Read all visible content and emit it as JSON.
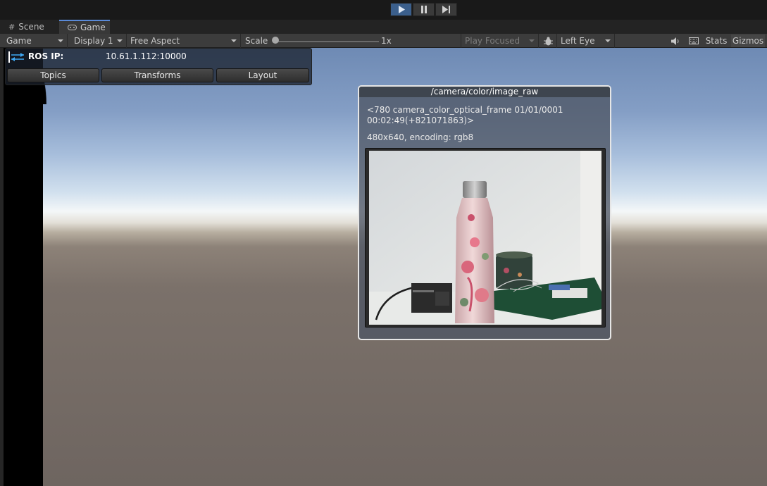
{
  "tabs": [
    {
      "label": "Scene",
      "icon": "grid-icon"
    },
    {
      "label": "Game",
      "icon": "gamepad-icon"
    }
  ],
  "toolbar": {
    "game_dropdown": "Game",
    "display_dropdown": "Display 1",
    "aspect_dropdown": "Free Aspect",
    "scale_label": "Scale",
    "scale_value": "1x",
    "play_focused": "Play Focused",
    "eye_dropdown": "Left Eye",
    "stats": "Stats",
    "gizmos": "Gizmos"
  },
  "ros": {
    "label": "ROS IP:",
    "ip": "10.61.1.112:10000",
    "buttons": [
      "Topics",
      "Transforms",
      "Layout"
    ]
  },
  "image_panel": {
    "title": "/camera/color/image_raw",
    "header": "<780 camera_color_optical_frame 01/01/0001 00:02:49(+821071863)>",
    "info": "480x640, encoding: rgb8"
  },
  "colors": {
    "accent": "#3b5f8c",
    "panel_border": "#e6e6e6",
    "ros_icon": "#3fa9f5"
  }
}
